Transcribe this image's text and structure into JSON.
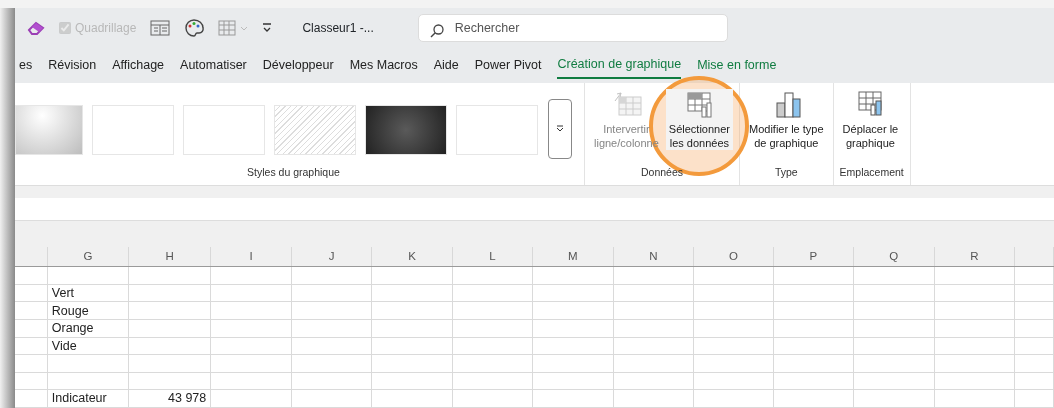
{
  "quick_access": {
    "gridlines": {
      "label": "Quadrillage",
      "checked": true,
      "disabled": true
    }
  },
  "window": {
    "title": "Classeur1 -..."
  },
  "search": {
    "placeholder": "Rechercher"
  },
  "tabs": [
    {
      "label": "es",
      "selected": false,
      "kind": "normal"
    },
    {
      "label": "Révision",
      "selected": false,
      "kind": "normal"
    },
    {
      "label": "Affichage",
      "selected": false,
      "kind": "normal"
    },
    {
      "label": "Automatiser",
      "selected": false,
      "kind": "normal"
    },
    {
      "label": "Développeur",
      "selected": false,
      "kind": "normal"
    },
    {
      "label": "Mes Macros",
      "selected": false,
      "kind": "normal"
    },
    {
      "label": "Aide",
      "selected": false,
      "kind": "normal"
    },
    {
      "label": "Power Pivot",
      "selected": false,
      "kind": "normal"
    },
    {
      "label": "Création de graphique",
      "selected": true,
      "kind": "contextual"
    },
    {
      "label": "Mise en forme",
      "selected": false,
      "kind": "contextual"
    }
  ],
  "styles_gallery": {
    "label": "Styles du graphique",
    "styles": [
      {
        "kind": "gradient"
      },
      {
        "kind": "plain"
      },
      {
        "kind": "plain"
      },
      {
        "kind": "hatched"
      },
      {
        "kind": "dark"
      },
      {
        "kind": "plain"
      }
    ]
  },
  "groups": [
    {
      "label": "Données",
      "buttons": [
        {
          "lines": [
            "Intervertir",
            "ligne/colonne"
          ],
          "disabled": true,
          "highlighted": false
        },
        {
          "lines": [
            "Sélectionner",
            "les données"
          ],
          "disabled": false,
          "highlighted": true
        }
      ]
    },
    {
      "label": "Type",
      "buttons": [
        {
          "lines": [
            "Modifier le type",
            "de graphique"
          ],
          "disabled": false,
          "highlighted": false
        }
      ]
    },
    {
      "label": "Emplacement",
      "buttons": [
        {
          "lines": [
            "Déplacer le",
            "graphique"
          ],
          "disabled": false,
          "highlighted": false
        }
      ]
    }
  ],
  "sheet": {
    "columns": [
      "",
      "G",
      "H",
      "I",
      "J",
      "K",
      "L",
      "M",
      "N",
      "O",
      "P",
      "Q",
      "R",
      ""
    ],
    "rows": [
      {
        "cells": [
          "",
          "",
          ""
        ]
      },
      {
        "cells": [
          "",
          "Vert",
          ""
        ]
      },
      {
        "cells": [
          "",
          "Rouge",
          ""
        ]
      },
      {
        "cells": [
          "",
          "Orange",
          ""
        ]
      },
      {
        "cells": [
          "",
          "Vide",
          ""
        ]
      },
      {
        "cells": [
          "",
          "",
          ""
        ]
      },
      {
        "cells": [
          "",
          "",
          ""
        ]
      },
      {
        "cells": [
          "",
          "Indicateur",
          "43 978"
        ]
      }
    ]
  }
}
